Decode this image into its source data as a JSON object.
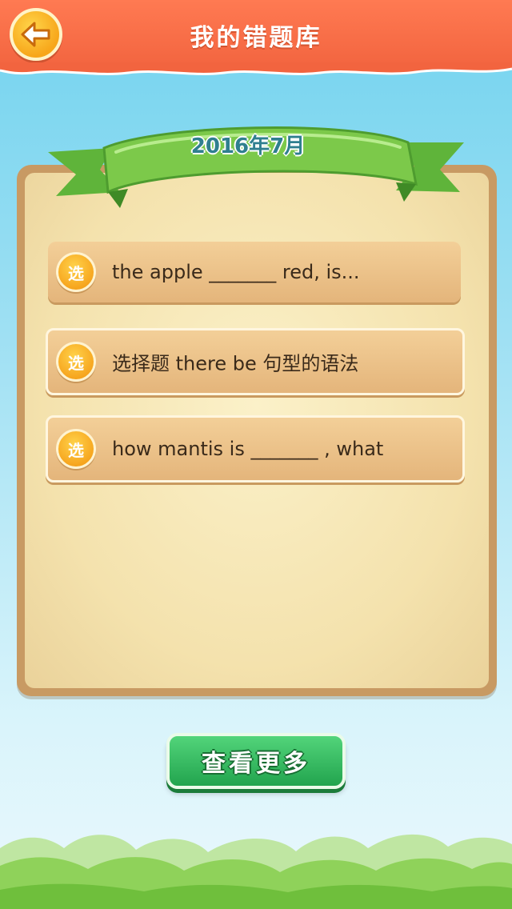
{
  "header": {
    "title": "我的错题库",
    "back_icon": "back-arrow-icon"
  },
  "colors": {
    "header": "#f2643f",
    "ribbon": "#7cc94a",
    "button": "#22a44e",
    "badge": "#f6a31c"
  },
  "board": {
    "date_label": "2016年7月",
    "items": [
      {
        "badge": "选",
        "text": "the apple _______ red, is..."
      },
      {
        "badge": "选",
        "text": "选择题 there be 句型的语法"
      },
      {
        "badge": "选",
        "text": "how mantis is _______ , what"
      }
    ]
  },
  "more_button": {
    "label": "查看更多"
  }
}
